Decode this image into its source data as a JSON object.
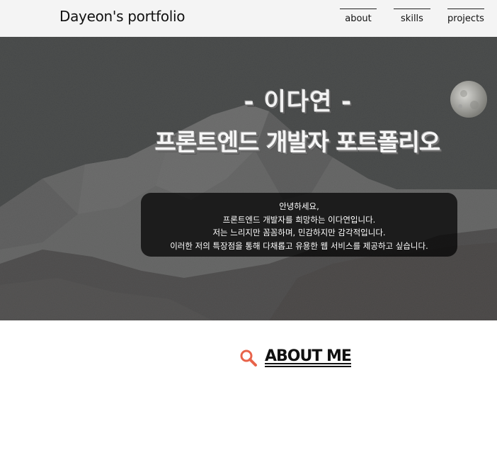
{
  "header": {
    "title": "Dayeon's portfolio",
    "nav": [
      "about",
      "skills",
      "projects"
    ]
  },
  "hero": {
    "name": "- 이다연 -",
    "subtitle": "프론트엔드 개발자 포트폴리오",
    "intro_lines": [
      "안녕하세요,",
      "프론트엔드 개발자를 희망하는 이다연입니다.",
      "저는 느리지만 꼼꼼하며, 민감하지만 감각적입니다.",
      "이러한 저의 특장점을 통해 다채롭고 유용한 웹 서비스를 제공하고 싶습니다."
    ]
  },
  "about": {
    "title": "ABOUT ME",
    "icon": "search-icon",
    "icon_color": "#e8634a"
  },
  "colors": {
    "header_bg": "#f4f4f4",
    "hero_sky": "#2b3534",
    "accent": "#e8634a"
  }
}
